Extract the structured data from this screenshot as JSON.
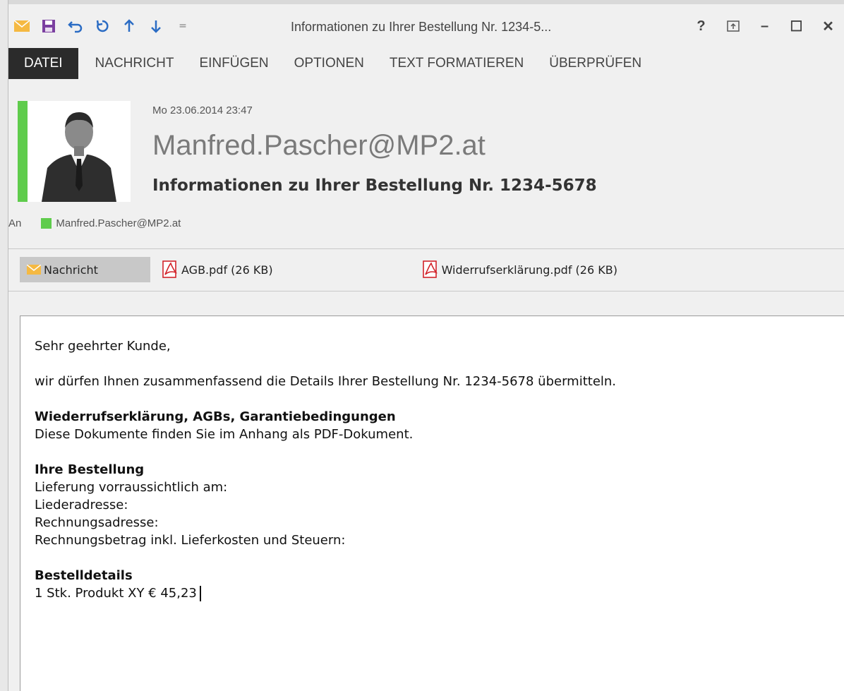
{
  "window": {
    "title": "Informationen zu Ihrer Bestellung Nr. 1234-5...",
    "help": "?",
    "minimize": "–",
    "maximize": "☐",
    "close": "✕",
    "qat_dropdown": "="
  },
  "ribbon": {
    "tabs": [
      "DATEI",
      "NACHRICHT",
      "EINFÜGEN",
      "OPTIONEN",
      "TEXT FORMATIEREN",
      "ÜBERPRÜFEN"
    ]
  },
  "header": {
    "date": "Mo 23.06.2014 23:47",
    "sender": "Manfred.Pascher@MP2.at",
    "subject": "Informationen zu Ihrer Bestellung Nr. 1234-5678",
    "to_label": "An",
    "to_value": "Manfred.Pascher@MP2.at"
  },
  "attachments": {
    "message_label": "Nachricht",
    "files": [
      "AGB.pdf (26 KB)",
      "Widerrufserklärung.pdf (26 KB)"
    ]
  },
  "body": {
    "greeting": "Sehr geehrter Kunde,",
    "intro": "wir dürfen Ihnen zusammenfassend die Details Ihrer Bestellung Nr. 1234-5678 übermitteln.",
    "section1_title": "Wiederrufserklärung, AGBs, Garantiebedingungen",
    "section1_text": "Diese Dokumente finden Sie im Anhang als PDF-Dokument.",
    "section2_title": "Ihre Bestellung",
    "section2_lines": [
      "Lieferung vorraussichtlich am:",
      "Liederadresse:",
      "Rechnungsadresse:",
      "Rechnungsbetrag inkl. Lieferkosten und Steuern:"
    ],
    "section3_title": "Bestelldetails",
    "section3_text": "1 Stk. Produkt XY € 45,23"
  },
  "colors": {
    "presence": "#5fcc4c",
    "file_tab": "#2b2b2b",
    "accent_purple": "#7b3fa0",
    "accent_blue": "#2b6cc4",
    "envelope": "#f5b942",
    "pdf_red": "#d2232a"
  }
}
